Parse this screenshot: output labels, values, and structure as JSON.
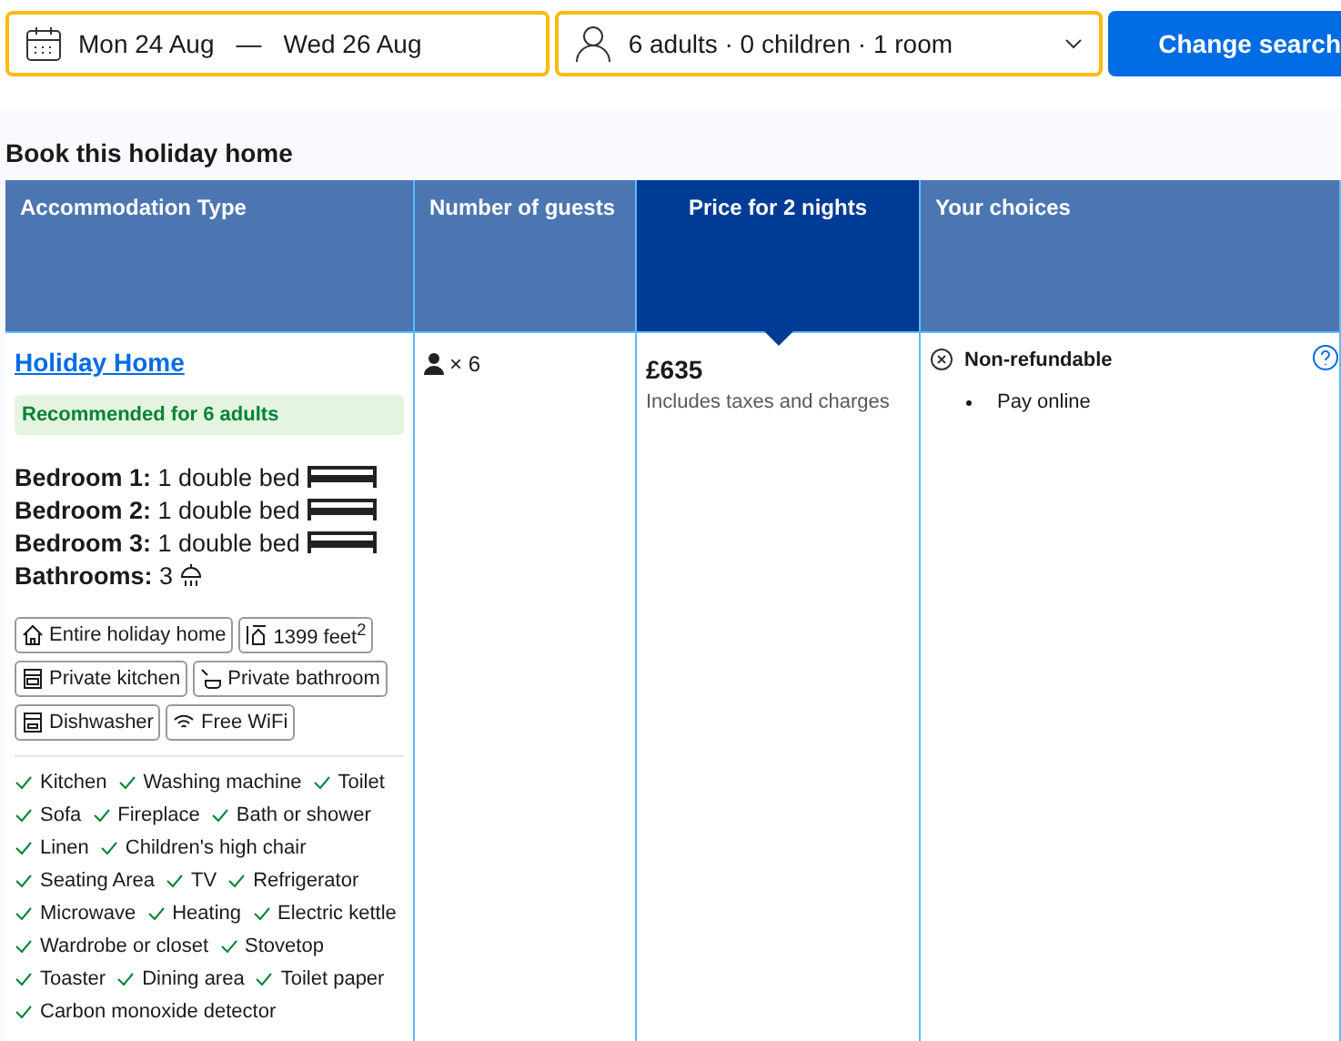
{
  "search": {
    "check_in": "Mon 24 Aug",
    "separator": "—",
    "check_out": "Wed 26 Aug",
    "guests": "6 adults · 0 children · 1 room",
    "button": "Change search"
  },
  "heading": "Book this holiday home",
  "columns": [
    {
      "label": "Accommodation Type",
      "selected": false
    },
    {
      "label": "Number of guests",
      "selected": false
    },
    {
      "label": "Price for 2 nights",
      "selected": true
    },
    {
      "label": "Your choices",
      "selected": false
    }
  ],
  "room": {
    "name": "Holiday Home",
    "recommendation": "Recommended for 6 adults",
    "beds": [
      {
        "text": "**Bedroom 1:** 1 double bed",
        "kind": "bed"
      },
      {
        "text": "**Bedroom 2:** 1 double bed",
        "kind": "bed"
      },
      {
        "text": "**Bedroom 3:** 1 double bed",
        "kind": "bed"
      },
      {
        "text": "**Bathrooms:** 3",
        "kind": "shower"
      }
    ],
    "facilities": [
      [
        {
          "label": "Entire holiday home",
          "kind": "house"
        },
        {
          "label": "1399 feet$^{2}$",
          "kind": "area"
        }
      ],
      [
        {
          "label": "Private kitchen",
          "kind": "kitchen"
        },
        {
          "label": "Private bathroom",
          "kind": "bath"
        }
      ],
      [
        {
          "label": "Dishwasher",
          "kind": "dishwasher"
        },
        {
          "label": "Free WiFi",
          "kind": "wifi"
        }
      ]
    ],
    "amenities": [
      [
        "Kitchen",
        "Washing machine",
        "Toilet"
      ],
      [
        "Sofa",
        "Fireplace",
        "Bath or shower"
      ],
      [
        "Linen",
        "Children's high chair"
      ],
      [
        "Seating Area",
        "TV",
        "Refrigerator"
      ],
      [
        "Microwave",
        "Heating",
        "Electric kettle"
      ],
      [
        "Wardrobe or closet",
        "Stovetop"
      ],
      [
        "Toaster",
        "Dining area",
        "Toilet paper"
      ],
      [
        "Carbon monoxide detector"
      ]
    ]
  },
  "guests": "× 6",
  "price": {
    "amount": "£635",
    "note": "Includes taxes and charges"
  },
  "choices": {
    "policy": "Non-refundable",
    "items": [
      "Pay online"
    ]
  }
}
